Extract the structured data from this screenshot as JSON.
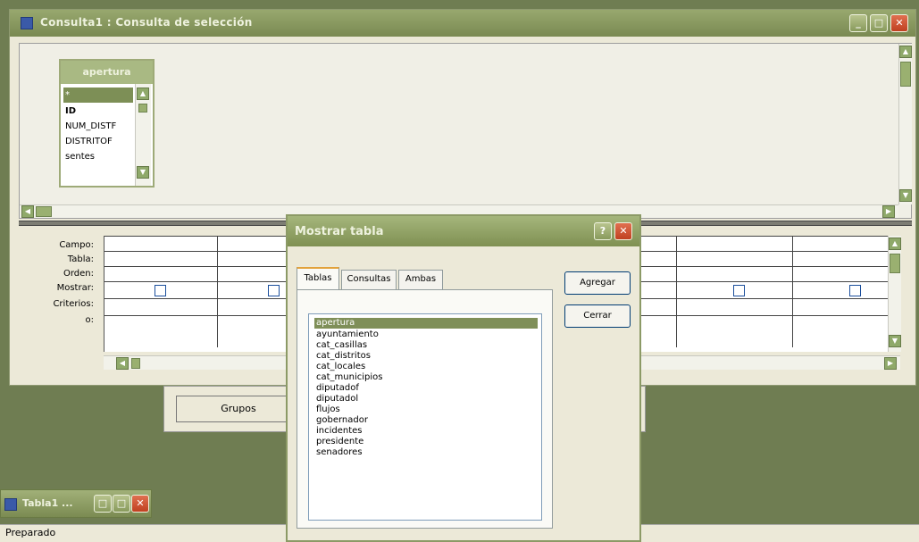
{
  "query_window": {
    "title": "Consulta1 : Consulta de selección",
    "buttons": {
      "minimize": "_",
      "maximize": "□",
      "close": "✕"
    }
  },
  "table_box": {
    "title": "apertura",
    "fields": [
      "*",
      "ID",
      "NUM_DISTF",
      "DISTRITOF",
      "sentes"
    ]
  },
  "design_grid": {
    "row_labels": [
      "Campo:",
      "Tabla:",
      "Orden:",
      "Mostrar:",
      "Criterios:",
      "o:"
    ]
  },
  "group_button": "Grupos",
  "minimized_window": {
    "title": "Tabla1 ..."
  },
  "status_bar": "Preparado",
  "dialog": {
    "title": "Mostrar tabla",
    "help": "?",
    "close": "✕",
    "tabs": [
      "Tablas",
      "Consultas",
      "Ambas"
    ],
    "active_tab": "Tablas",
    "buttons": {
      "add": "Agregar",
      "close": "Cerrar"
    },
    "tables": [
      "apertura",
      "ayuntamiento",
      "cat_casillas",
      "cat_distritos",
      "cat_locales",
      "cat_municipios",
      "diputadof",
      "diputadol",
      "flujos",
      "gobernador",
      "incidentes",
      "presidente",
      "senadores"
    ],
    "selected_table": "apertura"
  },
  "colors": {
    "titlebar": "#7f9052",
    "selection": "#7f8f58",
    "window_bg": "#ece9d8",
    "desktop": "#6f7d52"
  }
}
